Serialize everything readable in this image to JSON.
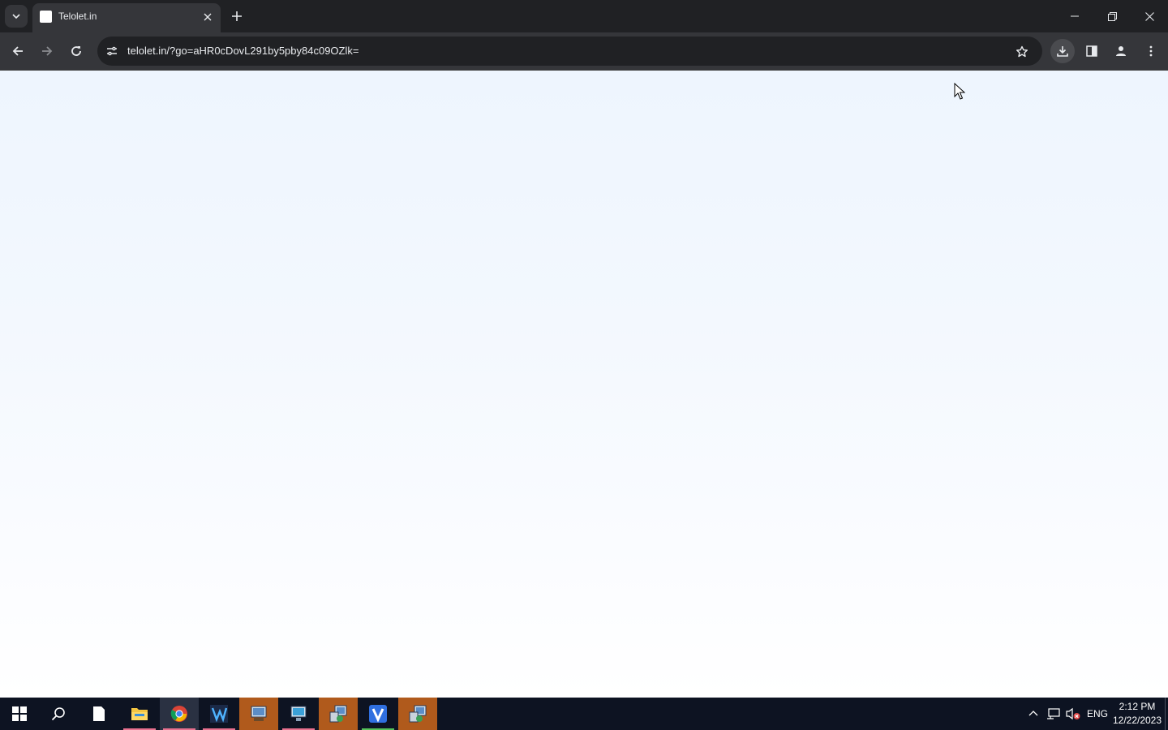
{
  "browser": {
    "tab": {
      "title": "Telolet.in"
    },
    "address_bar": {
      "url": "telolet.in/?go=aHR0cDovL291by5pby84c09OZlk="
    }
  },
  "taskbar": {
    "clock": {
      "time": "2:12 PM",
      "date": "12/22/2023"
    },
    "language": "ENG",
    "apps": [
      {
        "name": "file-explorer",
        "state": "indicator"
      },
      {
        "name": "chrome",
        "state": "active"
      },
      {
        "name": "vs-like-app",
        "state": "indicator"
      },
      {
        "name": "installer-app-1",
        "state": "orange"
      },
      {
        "name": "remote-desktop-app",
        "state": "indicator"
      },
      {
        "name": "installer-app-2",
        "state": "orange"
      },
      {
        "name": "v-app",
        "state": "indicator"
      },
      {
        "name": "installer-app-3",
        "state": "orange"
      }
    ]
  },
  "colors": {
    "chrome_dark": "#202124",
    "chrome_toolbar": "#35363a",
    "taskbar": "#0d1322",
    "indicator_pink": "#e8718f",
    "indicator_green": "#55c25a",
    "content_top": "#eef5fe"
  }
}
